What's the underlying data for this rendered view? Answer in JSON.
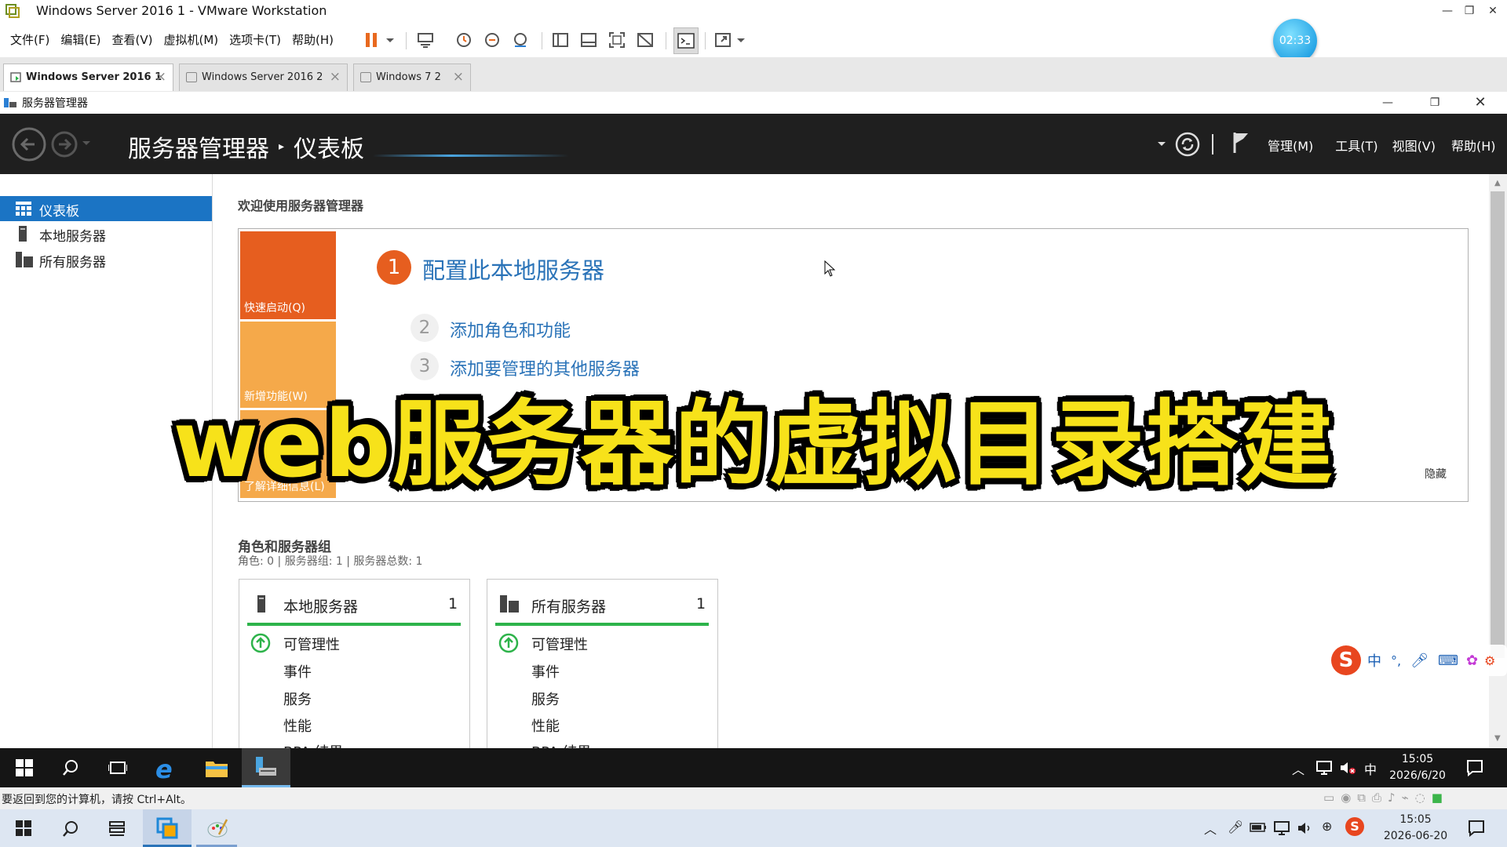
{
  "vmware": {
    "title": "Windows Server 2016 1 - VMware Workstation",
    "menu": [
      "文件(F)",
      "编辑(E)",
      "查看(V)",
      "虚拟机(M)",
      "选项卡(T)",
      "帮助(H)"
    ],
    "timer_badge": "02:33",
    "tabs": [
      {
        "label": "Windows Server 2016 1",
        "active": true
      },
      {
        "label": "Windows Server 2016 2",
        "active": false
      },
      {
        "label": "Windows 7 2",
        "active": false
      }
    ],
    "status_text": "要返回到您的计算机，请按 Ctrl+Alt。"
  },
  "server_manager": {
    "window_title": "服务器管理器",
    "breadcrumb_root": "服务器管理器",
    "breadcrumb_sep": "▸",
    "breadcrumb_page": "仪表板",
    "header_menu": [
      "管理(M)",
      "工具(T)",
      "视图(V)",
      "帮助(H)"
    ],
    "sidebar": [
      {
        "label": "仪表板",
        "active": true
      },
      {
        "label": "本地服务器",
        "active": false
      },
      {
        "label": "所有服务器",
        "active": false
      }
    ],
    "welcome_heading": "欢迎使用服务器管理器",
    "quick_start": {
      "tile_quick": "快速启动(Q)",
      "tile_new": "新增功能(W)",
      "tile_learn": "了解详细信息(L)",
      "step1_num": "1",
      "step1_label": "配置此本地服务器",
      "step2_num": "2",
      "step2_label": "添加角色和功能",
      "step3_num": "3",
      "step3_label": "添加要管理的其他服务器",
      "hide_label": "隐藏"
    },
    "roles": {
      "heading": "角色和服务器组",
      "summary": "角色: 0 | 服务器组: 1 | 服务器总数: 1"
    },
    "cards": [
      {
        "title": "本地服务器",
        "count": "1",
        "rows": [
          "可管理性",
          "事件",
          "服务",
          "性能",
          "BPA 结果"
        ]
      },
      {
        "title": "所有服务器",
        "count": "1",
        "rows": [
          "可管理性",
          "事件",
          "服务",
          "性能",
          "BPA 结果"
        ]
      }
    ]
  },
  "ime": {
    "mode": "中",
    "punct": "°,"
  },
  "guest_taskbar": {
    "time": "15:05",
    "date": "2026/6/20",
    "ime": "中"
  },
  "host_taskbar": {
    "time": "15:05",
    "date": "2026-06-20"
  },
  "caption": "web服务器的虚拟目录搭建",
  "colors": {
    "accent_blue": "#1b74c4",
    "quick_orange": "#e65e1f",
    "tile_amber": "#f5a94a",
    "status_green": "#2db34a",
    "caption_yellow": "#f7e21a"
  }
}
